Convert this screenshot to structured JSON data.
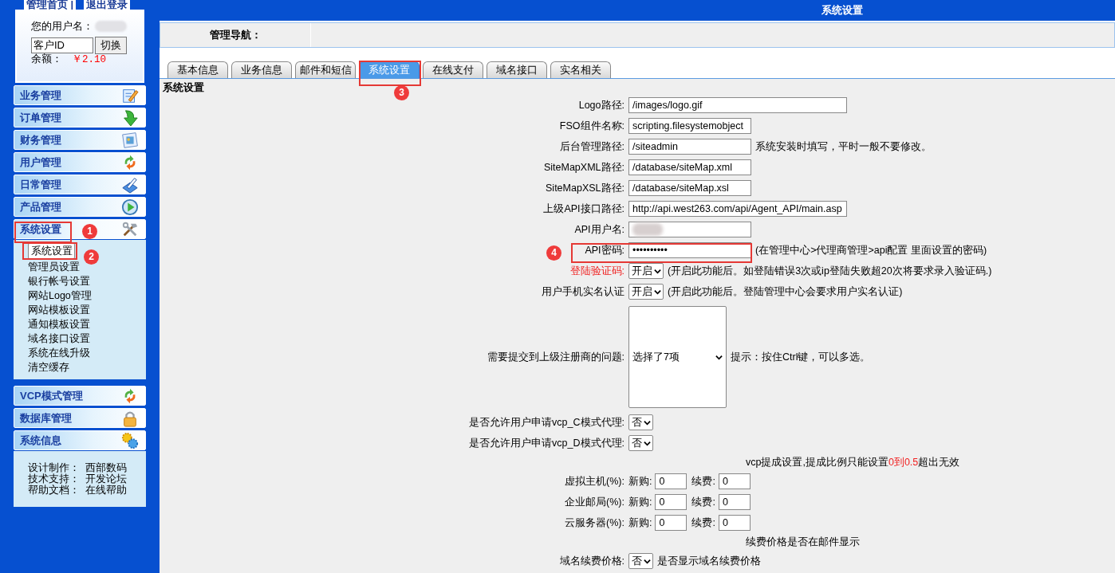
{
  "sidebar": {
    "top_links": [
      "管理首页 |",
      "退出登录"
    ],
    "user_panel": {
      "username_label": "您的用户名：",
      "id_field": "客户ID",
      "switch_button": "切换",
      "balance_label": "余额：",
      "balance": "￥2.10"
    },
    "menu": [
      {
        "label": "业务管理",
        "expanded": false
      },
      {
        "label": "订单管理",
        "expanded": false
      },
      {
        "label": "财务管理",
        "expanded": false
      },
      {
        "label": "用户管理",
        "expanded": false
      },
      {
        "label": "日常管理",
        "expanded": false
      },
      {
        "label": "产品管理",
        "expanded": false
      },
      {
        "label": "系统设置",
        "expanded": true,
        "children": [
          {
            "label": "系统设置",
            "selected": true
          },
          {
            "label": "管理员设置",
            "selected": false
          },
          {
            "label": "银行帐号设置",
            "selected": false
          },
          {
            "label": "网站Logo管理",
            "selected": false
          },
          {
            "label": "网站模板设置",
            "selected": false
          },
          {
            "label": "通知模板设置",
            "selected": false
          },
          {
            "label": "域名接口设置",
            "selected": false
          },
          {
            "label": "系统在线升级",
            "selected": false
          },
          {
            "label": "清空缓存",
            "selected": false
          }
        ]
      },
      {
        "label": "VCP模式管理",
        "expanded": false
      },
      {
        "label": "数据库管理",
        "expanded": false
      },
      {
        "label": "系统信息",
        "expanded": false
      }
    ],
    "info": [
      {
        "label": "设计制作：",
        "value": "西部数码"
      },
      {
        "label": "技术支持：",
        "value": "开发论坛"
      },
      {
        "label": "帮助文档：",
        "value": "在线帮助"
      }
    ]
  },
  "header": {
    "title": "系统设置",
    "nav_label": "管理导航："
  },
  "tabs": [
    {
      "label": "基本信息",
      "selected": false
    },
    {
      "label": "业务信息",
      "selected": false
    },
    {
      "label": "邮件和短信",
      "selected": false
    },
    {
      "label": "系统设置",
      "selected": true
    },
    {
      "label": "在线支付",
      "selected": false
    },
    {
      "label": "域名接口",
      "selected": false
    },
    {
      "label": "实名相关",
      "selected": false
    }
  ],
  "form": {
    "title": "系统设置",
    "rows": [
      {
        "kind": "text",
        "label": "Logo路径:",
        "value": "/images/logo.gif",
        "wide": true
      },
      {
        "kind": "text",
        "label": "FSO组件名称:",
        "value": "scripting.filesystemobject",
        "wide": false
      },
      {
        "kind": "text",
        "label": "后台管理路径:",
        "value": "/siteadmin",
        "wide": false,
        "note": "系统安装时填写，平时一般不要修改。"
      },
      {
        "kind": "text",
        "label": "SiteMapXML路径:",
        "value": "/database/siteMap.xml",
        "wide": false
      },
      {
        "kind": "text",
        "label": "SiteMapXSL路径:",
        "value": "/database/siteMap.xsl",
        "wide": false
      },
      {
        "kind": "text",
        "label": "上级API接口路径:",
        "value": "http://api.west263.com/api/Agent_API/main.asp",
        "wide": true
      },
      {
        "kind": "blurred",
        "label": "API用户名:"
      },
      {
        "kind": "text",
        "label": "API密码:",
        "value": "••••••••••",
        "wide": false,
        "note": "(在管理中心>代理商管理>api配置 里面设置的密码)"
      },
      {
        "kind": "select",
        "label": "登陆验证码:",
        "warning": true,
        "value": "开启",
        "note": "(开启此功能后。如登陆错误3次或ip登陆失败超20次将要求录入验证码.)"
      },
      {
        "kind": "select",
        "label": "用户手机实名认证",
        "warning": false,
        "value": "开启",
        "note": "(开启此功能后。登陆管理中心会要求用户实名认证)"
      },
      {
        "kind": "multi",
        "label": "需要提交到上级注册商的问题:",
        "value": "选择了7项",
        "note": "提示：按住Ctrl键，可以多选。"
      },
      {
        "kind": "select",
        "label": "是否允许用户申请vcp_C模式代理:",
        "warning": false,
        "value": "否"
      },
      {
        "kind": "select",
        "label": "是否允许用户申请vcp_D模式代理:",
        "warning": false,
        "value": "否"
      },
      {
        "kind": "heading",
        "segments": [
          {
            "text": "vcp提成设置,提成比例只能设置",
            "highlight": false
          },
          {
            "text": "0到0.5",
            "highlight": true
          },
          {
            "text": "超出无效",
            "highlight": false
          }
        ]
      },
      {
        "kind": "percent",
        "label": "虚拟主机(%):",
        "new_label": "新购:",
        "new_value": "0",
        "renew_label": "续费:",
        "renew_value": "0"
      },
      {
        "kind": "percent",
        "label": "企业邮局(%):",
        "new_label": "新购:",
        "new_value": "0",
        "renew_label": "续费:",
        "renew_value": "0"
      },
      {
        "kind": "percent",
        "label": "云服务器(%):",
        "new_label": "新购:",
        "new_value": "0",
        "renew_label": "续费:",
        "renew_value": "0"
      },
      {
        "kind": "heading",
        "segments": [
          {
            "text": "续费价格是否在邮件显示",
            "highlight": false
          }
        ]
      },
      {
        "kind": "select",
        "label": "域名续费价格:",
        "warning": false,
        "value": "否",
        "note": "是否显示域名续费价格"
      }
    ]
  },
  "annotations": [
    {
      "number": "1"
    },
    {
      "number": "2"
    },
    {
      "number": "3"
    },
    {
      "number": "4"
    }
  ]
}
